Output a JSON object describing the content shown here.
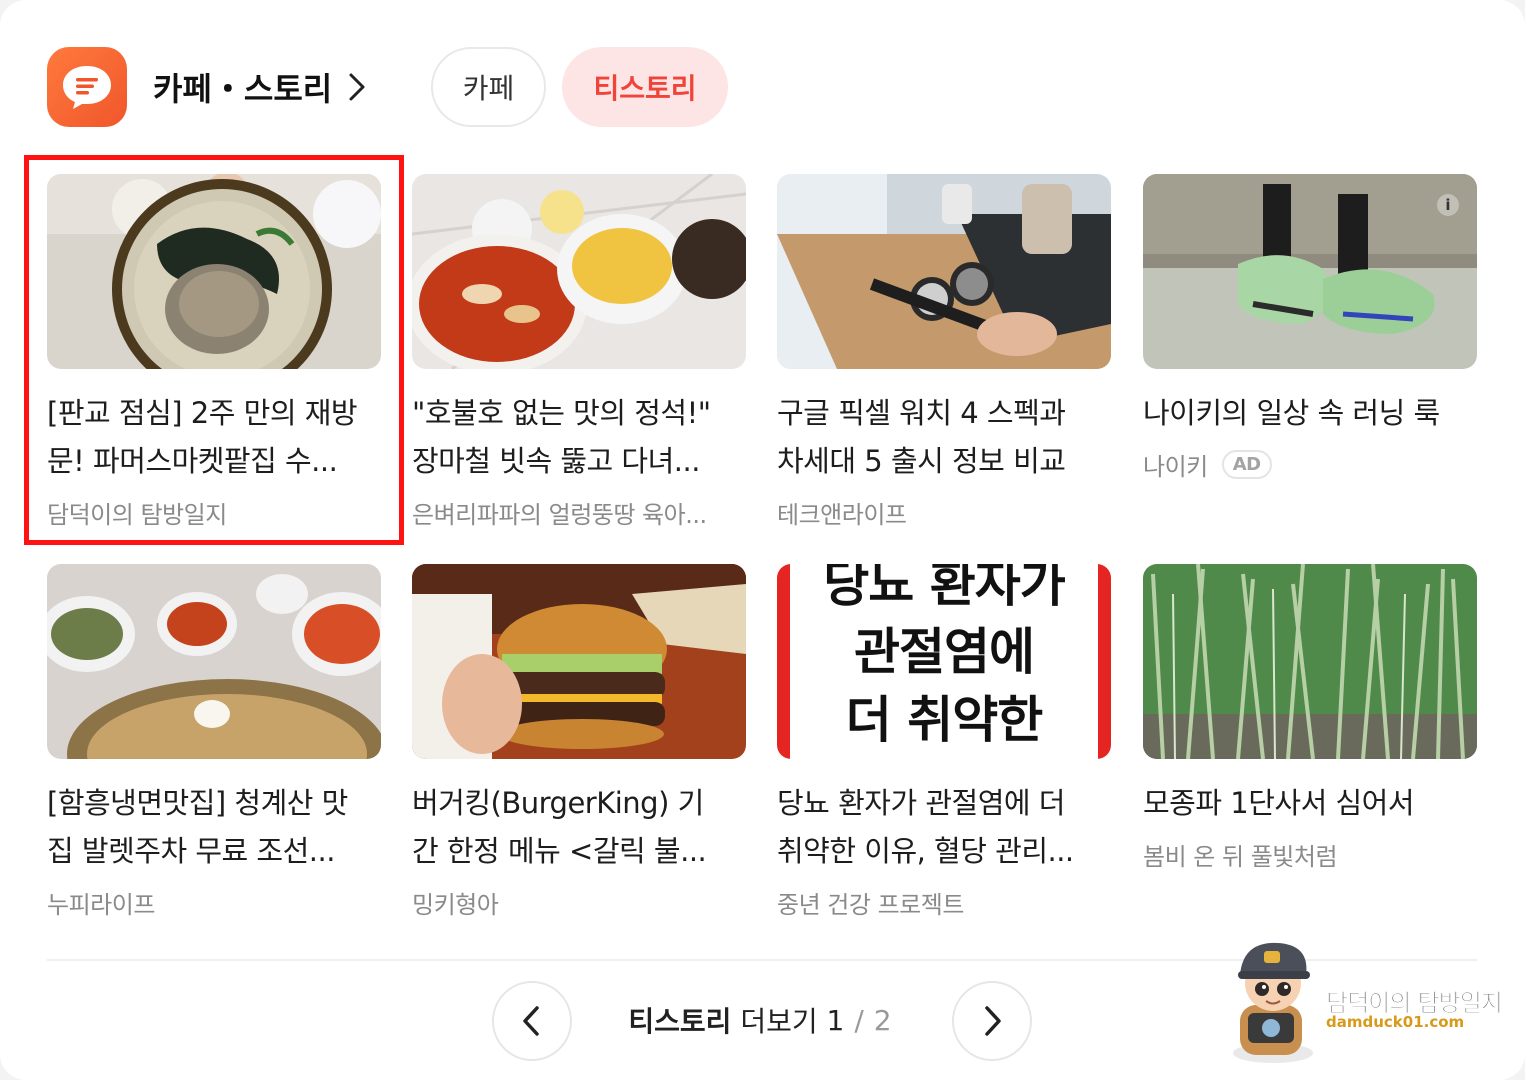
{
  "header": {
    "title": "카페・스토리",
    "tabs": [
      {
        "label": "카페",
        "active": false
      },
      {
        "label": "티스토리",
        "active": true
      }
    ]
  },
  "cards": [
    {
      "title_line1": "[판교 점심] 2주 만의 재방",
      "title_line2": "문! 파머스마켓팥집 수...",
      "source": "담덕이의 탐방일지",
      "highlighted": true
    },
    {
      "title_line1": "\"호불호 없는 맛의 정석!\"",
      "title_line2": "장마철 빗속 뚫고 다녀...",
      "source": "은벼리파파의 얼렁뚱땅 육아..."
    },
    {
      "title_line1": "구글 픽셀 워치 4 스펙과",
      "title_line2": "차세대 5 출시 정보 비교",
      "source": "테크앤라이프"
    },
    {
      "title_line1": "나이키의 일상 속 러닝 룩",
      "title_line2": "",
      "source": "나이키",
      "badge": "AD"
    },
    {
      "title_line1": "[함흥냉면맛집] 청계산 맛",
      "title_line2": "집 발렛주차 무료 조선...",
      "source": "누피라이프"
    },
    {
      "title_line1": "버거킹(BurgerKing) 기",
      "title_line2": "간 한정 메뉴 <갈릭 불...",
      "source": "밍키형아"
    },
    {
      "title_line1": "당뇨 환자가 관절염에 더",
      "title_line2": "취약한 이유, 혈당 관리...",
      "source": "중년 건강 프로젝트",
      "thumb_text": [
        "당뇨 환자가",
        "관절염에",
        "더 취약한"
      ]
    },
    {
      "title_line1": "모종파 1단사서 심어서",
      "title_line2": "",
      "source": "봄비 온 뒤 풀빛처럼"
    }
  ],
  "pagination": {
    "more_strong": "티스토리",
    "more_label": "더보기",
    "current": "1",
    "separator": "/",
    "total": "2"
  },
  "watermark": {
    "name": "담덕이의 탐방일지",
    "url": "damduck01.com"
  },
  "colors": {
    "accent": "#f0443a",
    "tab_active_bg": "#fde5e5",
    "logo": "#f0562b",
    "highlight": "#ff1212"
  }
}
